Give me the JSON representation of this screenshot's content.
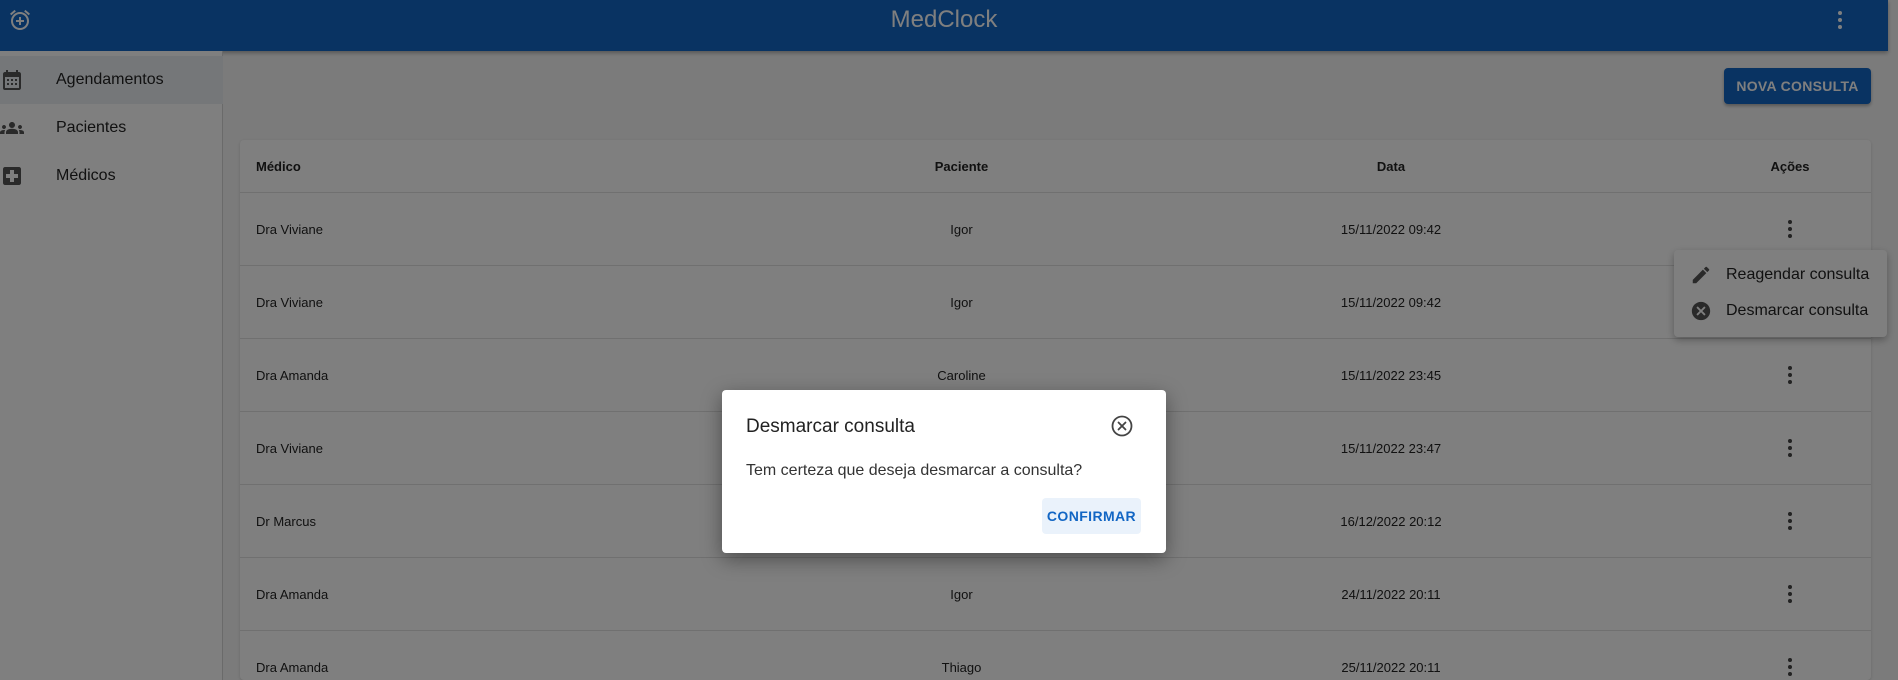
{
  "app": {
    "title": "MedClock"
  },
  "header": {
    "alarm_icon": "alarm-add-icon",
    "menu_icon": "more-vert-icon"
  },
  "sidebar": {
    "items": [
      {
        "label": "Agendamentos",
        "icon": "calendar-icon",
        "active": true
      },
      {
        "label": "Pacientes",
        "icon": "people-icon",
        "active": false
      },
      {
        "label": "Médicos",
        "icon": "medical-plus-icon",
        "active": false
      }
    ]
  },
  "toolbar": {
    "new_label": "NOVA CONSULTA"
  },
  "table": {
    "headers": {
      "medico": "Médico",
      "paciente": "Paciente",
      "data": "Data",
      "acoes": "Ações"
    },
    "rows": [
      {
        "medico": "Dra Viviane",
        "paciente": "Igor",
        "data": "15/11/2022 09:42"
      },
      {
        "medico": "Dra Viviane",
        "paciente": "Igor",
        "data": "15/11/2022 09:42"
      },
      {
        "medico": "Dra Amanda",
        "paciente": "Caroline",
        "data": "15/11/2022 23:45"
      },
      {
        "medico": "Dra Viviane",
        "paciente": "",
        "data": "15/11/2022 23:47"
      },
      {
        "medico": "Dr Marcus",
        "paciente": "",
        "data": "16/12/2022 20:12"
      },
      {
        "medico": "Dra Amanda",
        "paciente": "Igor",
        "data": "24/11/2022 20:11"
      },
      {
        "medico": "Dra Amanda",
        "paciente": "Thiago",
        "data": "25/11/2022 20:11"
      }
    ]
  },
  "context_menu": {
    "items": [
      {
        "label": "Reagendar consulta",
        "icon": "pencil-icon"
      },
      {
        "label": "Desmarcar consulta",
        "icon": "cancel-circle-icon"
      }
    ]
  },
  "dialog": {
    "title": "Desmarcar consulta",
    "message": "Tem certeza que deseja desmarcar a consulta?",
    "confirm_label": "CONFIRMAR"
  },
  "colors": {
    "primary": "#1266c4",
    "overlay": "rgba(0,0,0,0.5)"
  }
}
